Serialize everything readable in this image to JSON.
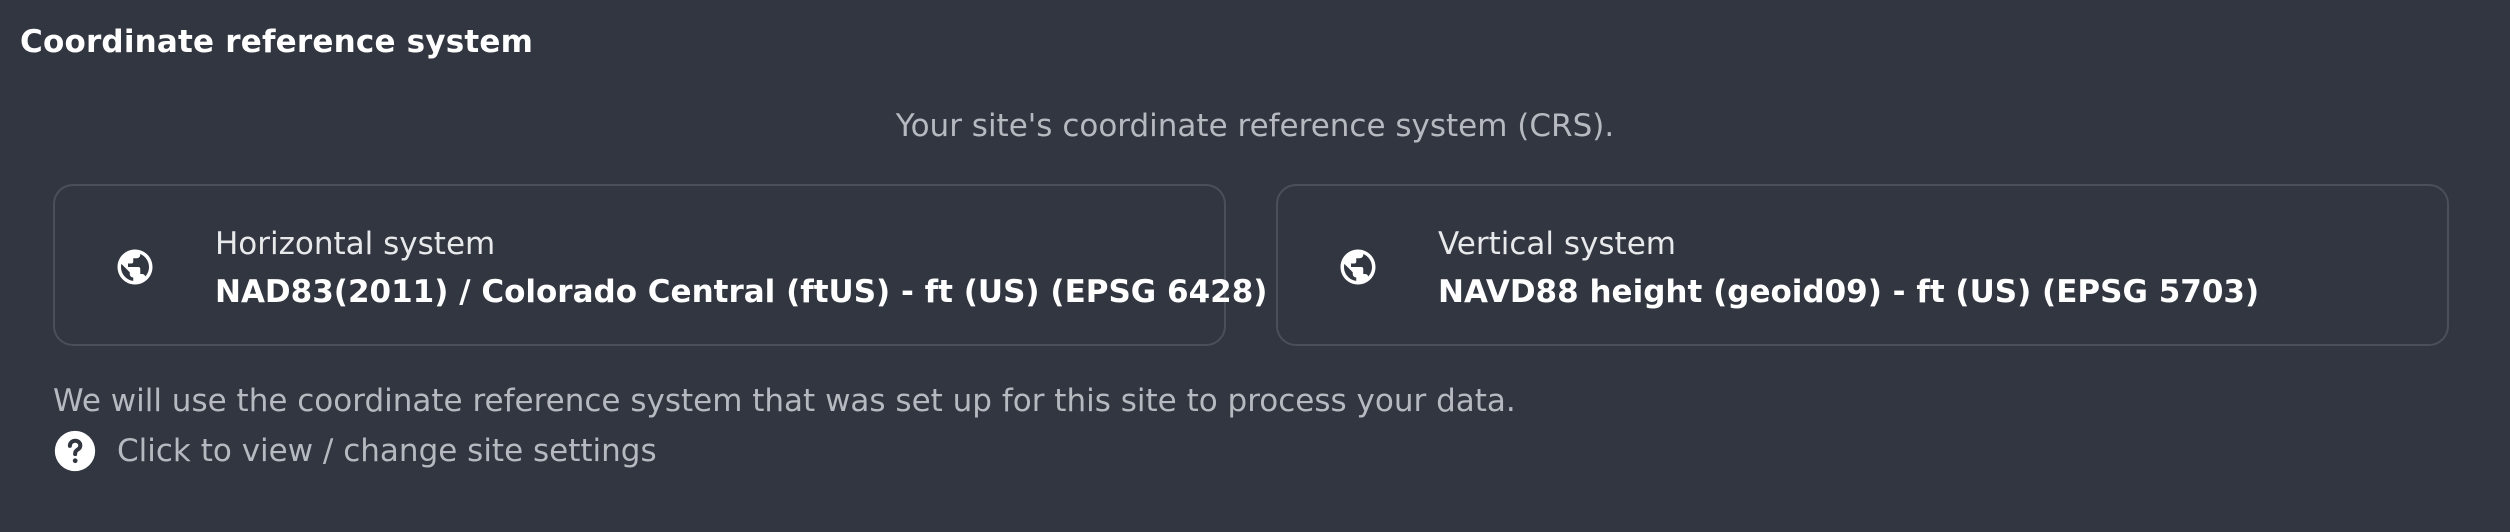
{
  "section": {
    "title": "Coordinate reference system",
    "subtitle": "Your site's coordinate reference system (CRS)."
  },
  "horizontal": {
    "icon": "globe-icon",
    "label": "Horizontal system",
    "value": "NAD83(2011) / Colorado Central (ftUS) - ft (US) (EPSG 6428)"
  },
  "vertical": {
    "icon": "globe-icon",
    "label": "Vertical system",
    "value": "NAVD88 height (geoid09) - ft (US) (EPSG 5703)"
  },
  "footer": {
    "note": "We will use the coordinate reference system that was set up for this site to process your data.",
    "settings_icon": "help-circle-icon",
    "settings_link": "Click to view / change site settings"
  },
  "colors": {
    "background": "#313640",
    "card_border": "#4a505b",
    "muted_text": "#b6b9bf",
    "primary_text": "#ffffff"
  }
}
